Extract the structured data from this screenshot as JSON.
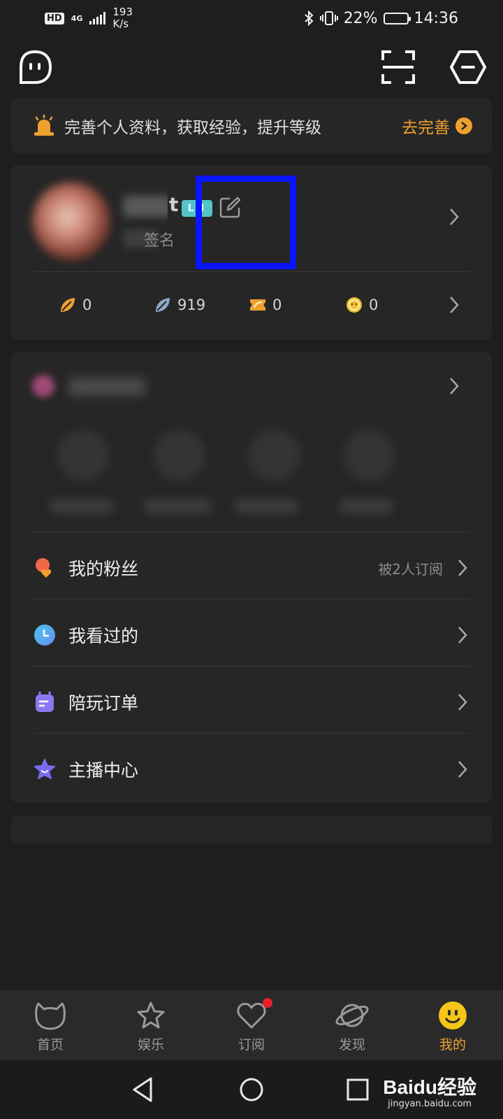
{
  "status_bar": {
    "hd": "HD",
    "network": "4G",
    "speed": "193",
    "speed_unit": "K/s",
    "battery": "22%",
    "time": "14:36"
  },
  "top_bar": {
    "left_icon": "robot-face-icon",
    "scan_icon": "scan-icon",
    "settings_icon": "hexagon-settings-icon"
  },
  "banner": {
    "text": "完善个人资料，获取经验，提升等级",
    "action": "去完善"
  },
  "profile": {
    "name_tail": "t",
    "level": "LH",
    "signature_tail": "签名"
  },
  "stats": [
    {
      "icon": "gold-leaf-icon",
      "value": "0"
    },
    {
      "icon": "silver-leaf-icon",
      "value": "919"
    },
    {
      "icon": "ticket-icon",
      "value": "0"
    },
    {
      "icon": "coin-icon",
      "value": "0"
    }
  ],
  "menu": [
    {
      "label": "我的粉丝",
      "sub": "被2人订阅",
      "icon": "fans-icon"
    },
    {
      "label": "我看过的",
      "sub": "",
      "icon": "history-clock-icon"
    },
    {
      "label": "陪玩订单",
      "sub": "",
      "icon": "order-icon"
    },
    {
      "label": "主播中心",
      "sub": "",
      "icon": "anchor-star-icon"
    }
  ],
  "tabs": [
    {
      "label": "首页",
      "icon": "cat-head-icon",
      "active": false
    },
    {
      "label": "娱乐",
      "icon": "star-icon",
      "active": false
    },
    {
      "label": "订阅",
      "icon": "heart-icon",
      "active": false,
      "badge": true
    },
    {
      "label": "发现",
      "icon": "planet-icon",
      "active": false
    },
    {
      "label": "我的",
      "icon": "smiley-icon",
      "active": true
    }
  ],
  "watermark": {
    "main": "Baidu经验",
    "sub": "jingyan.baidu.com"
  },
  "colors": {
    "background": "#1e1e1e",
    "card": "#262626",
    "accent": "#f0a030",
    "highlight": "#0a14ff",
    "badge": "#e8202a"
  }
}
